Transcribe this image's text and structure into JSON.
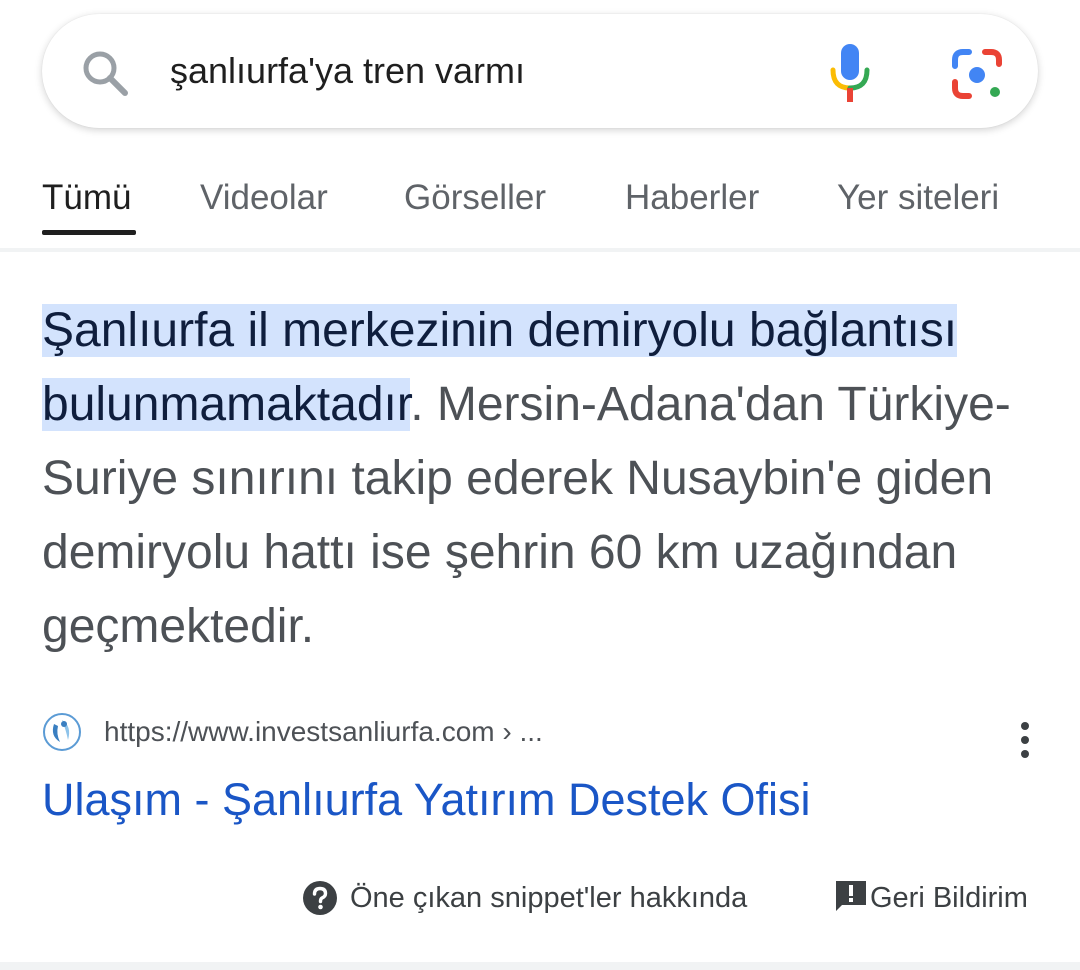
{
  "search": {
    "query": "şanlıurfa'ya tren varmı"
  },
  "tabs": [
    {
      "label": "Tümü",
      "active": true
    },
    {
      "label": "Videolar",
      "active": false
    },
    {
      "label": "Görseller",
      "active": false
    },
    {
      "label": "Haberler",
      "active": false
    },
    {
      "label": "Yer siteleri",
      "active": false
    }
  ],
  "snippet": {
    "highlighted_text": "Şanlıurfa il merkezinin demiryolu bağlantısı bulunmamaktadır",
    "rest_text": ". Mersin-Adana'dan Türkiye-Suriye sınırını takip ederek Nusaybin'e giden demiryolu hattı ise şehrin 60 km uzağından geçmektedir."
  },
  "result": {
    "url": "https://www.investsanliurfa.com › ...",
    "title": "Ulaşım - Şanlıurfa Yatırım Destek Ofisi"
  },
  "footer": {
    "about_label": "Öne çıkan snippet'ler hakkında",
    "feedback_label": "Geri Bildirim"
  },
  "icons": {
    "search": "search-icon",
    "mic": "mic-icon",
    "lens": "lens-icon",
    "favicon": "site-favicon-icon",
    "more": "more-vert-icon",
    "help": "help-circle-icon",
    "feedback": "feedback-icon"
  },
  "colors": {
    "highlight": "#d3e3fd",
    "link": "#1a56c6",
    "google_blue": "#4285f4",
    "google_red": "#ea4335",
    "google_yellow": "#fbbc04",
    "google_green": "#34a853"
  }
}
